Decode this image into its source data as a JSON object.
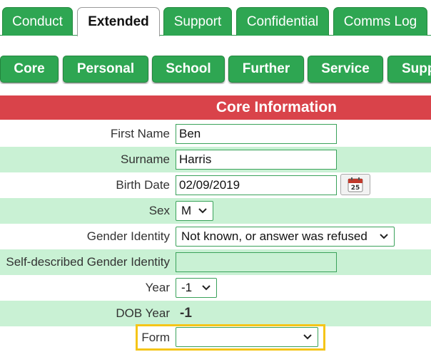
{
  "tabs": [
    {
      "label": "Conduct",
      "active": false
    },
    {
      "label": "Extended",
      "active": true
    },
    {
      "label": "Support",
      "active": false
    },
    {
      "label": "Confidential",
      "active": false
    },
    {
      "label": "Comms Log",
      "active": false
    }
  ],
  "subtabs": [
    {
      "label": "Core"
    },
    {
      "label": "Personal"
    },
    {
      "label": "School"
    },
    {
      "label": "Further"
    },
    {
      "label": "Service"
    },
    {
      "label": "Supp"
    }
  ],
  "section": {
    "title": "Core Information"
  },
  "form": {
    "first_name": {
      "label": "First Name",
      "value": "Ben"
    },
    "surname": {
      "label": "Surname",
      "value": "Harris"
    },
    "birth_date": {
      "label": "Birth Date",
      "value": "02/09/2019",
      "calendar_day": "25"
    },
    "sex": {
      "label": "Sex",
      "value": "M"
    },
    "gender_identity": {
      "label": "Gender Identity",
      "value": "Not known, or answer was refused"
    },
    "self_described": {
      "label": "Self-described Gender Identity",
      "value": ""
    },
    "year": {
      "label": "Year",
      "value": "-1"
    },
    "dob_year": {
      "label": "DOB Year",
      "value": "-1"
    },
    "form": {
      "label": "Form",
      "value": ""
    }
  },
  "colors": {
    "tab_green": "#2ea652",
    "section_red": "#d9434a",
    "row_alt": "#c9f1d4",
    "highlight": "#f5c518"
  }
}
